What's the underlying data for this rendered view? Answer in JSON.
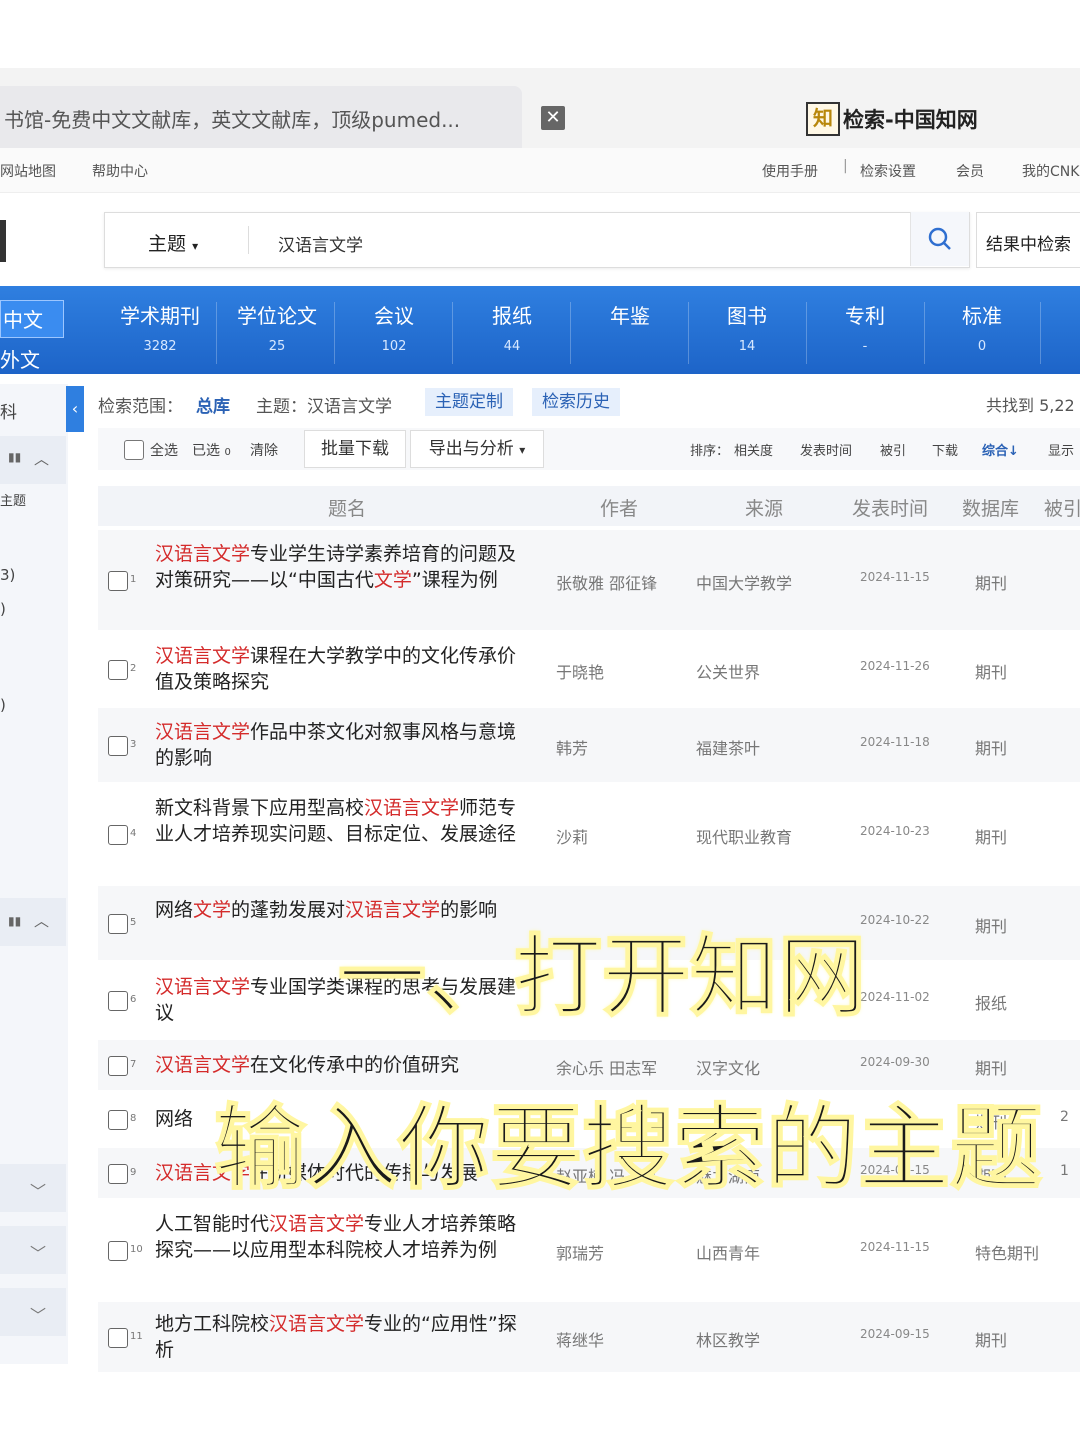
{
  "browser": {
    "tab1_title": "书馆-免费中文文献库，英文文献库，顶级pumed...",
    "tab2_logo": "知",
    "tab2_title": "检索-中国知网"
  },
  "util_links": [
    "网站地图",
    "帮助中心",
    "使用手册",
    "检索设置",
    "会员",
    "我的CNKI"
  ],
  "search": {
    "field": "主题",
    "query": "汉语言文学",
    "in_result_label": "结果中检索"
  },
  "lang": [
    "中文",
    "外文"
  ],
  "db_tabs": [
    {
      "label": "学术期刊",
      "count": "3282"
    },
    {
      "label": "学位论文",
      "count": "25"
    },
    {
      "label": "会议",
      "count": "102"
    },
    {
      "label": "报纸",
      "count": "44"
    },
    {
      "label": "年鉴",
      "count": ""
    },
    {
      "label": "图书",
      "count": "14"
    },
    {
      "label": "专利",
      "count": "-"
    },
    {
      "label": "标准",
      "count": "0"
    }
  ],
  "sidebar": {
    "items": [
      "科",
      "主题",
      "3)",
      ")",
      ")"
    ]
  },
  "range": {
    "label": "检索范围：",
    "scope": "总库",
    "topic": "主题：汉语言文学",
    "chip1": "主题定制",
    "chip2": "检索历史",
    "found": "共找到 5,22"
  },
  "toolbar": {
    "select_all": "全选",
    "selected": "已选",
    "selected_count": "0",
    "clear": "清除",
    "bulk_download": "批量下载",
    "export": "导出与分析",
    "sort_label": "排序：",
    "sort_options": [
      "相关度",
      "发表时间",
      "被引",
      "下载",
      "综合"
    ],
    "display": "显示"
  },
  "table": {
    "headers": [
      "题名",
      "作者",
      "来源",
      "发表时间",
      "数据库",
      "被引"
    ],
    "rows": [
      {
        "num": "1",
        "title": [
          [
            "汉语言文学",
            true
          ],
          [
            "专业学生诗学素养培育的问题及对策研究——以“中国古代",
            false
          ],
          [
            "文学",
            true
          ],
          [
            "”课程为例",
            false
          ]
        ],
        "author": "张敬雅 邵征锋",
        "source": "中国大学教学",
        "date": "2024-11-15",
        "db": "期刊",
        "cited": ""
      },
      {
        "num": "2",
        "title": [
          [
            "汉语言文学",
            true
          ],
          [
            "课程在大学教学中的文化传承价值及策略探究",
            false
          ]
        ],
        "author": "于晓艳",
        "source": "公关世界",
        "date": "2024-11-26",
        "db": "期刊",
        "cited": ""
      },
      {
        "num": "3",
        "title": [
          [
            "汉语言文学",
            true
          ],
          [
            "作品中茶文化对叙事风格与意境的影响",
            false
          ]
        ],
        "author": "韩芳",
        "source": "福建茶叶",
        "date": "2024-11-18",
        "db": "期刊",
        "cited": ""
      },
      {
        "num": "4",
        "title": [
          [
            "新文科背景下应用型高校",
            false
          ],
          [
            "汉语言文学",
            true
          ],
          [
            "师范专业人才培养现实问题、目标定位、发展途径",
            false
          ]
        ],
        "author": "沙莉",
        "source": "现代职业教育",
        "date": "2024-10-23",
        "db": "期刊",
        "cited": ""
      },
      {
        "num": "5",
        "title": [
          [
            "网络",
            false
          ],
          [
            "文学",
            true
          ],
          [
            "的蓬勃发展对",
            false
          ],
          [
            "汉语言文学",
            true
          ],
          [
            "的影响",
            false
          ]
        ],
        "author": "",
        "source": "",
        "date": "2024-10-22",
        "db": "期刊",
        "cited": ""
      },
      {
        "num": "6",
        "title": [
          [
            "汉语言文学",
            true
          ],
          [
            "专业国学类课程的思考与发展建议",
            false
          ]
        ],
        "author": "",
        "source": "",
        "date": "2024-11-02",
        "db": "报纸",
        "cited": ""
      },
      {
        "num": "7",
        "title": [
          [
            "汉语言文学",
            true
          ],
          [
            "在文化传承中的价值研究",
            false
          ]
        ],
        "author": "余心乐 田志军",
        "source": "汉字文化",
        "date": "2024-09-30",
        "db": "期刊",
        "cited": ""
      },
      {
        "num": "8",
        "title": [
          [
            "网络",
            false
          ]
        ],
        "author": "",
        "source": "",
        "date": "",
        "db": "期刊",
        "cited": "2"
      },
      {
        "num": "9",
        "title": [
          [
            "汉语言文学",
            true
          ],
          [
            "在新媒体时代的传播与发展",
            false
          ]
        ],
        "author": "赵亚楠 冯三等",
        "source": "魅力湖南",
        "date": "2024-08-15",
        "db": "期刊",
        "cited": "1"
      },
      {
        "num": "10",
        "title": [
          [
            "人工智能时代",
            false
          ],
          [
            "汉语言文学",
            true
          ],
          [
            "专业人才培养策略探究——以应用型本科院校人才培养为例",
            false
          ]
        ],
        "author": "郭瑞芳",
        "source": "山西青年",
        "date": "2024-11-15",
        "db": "特色期刊",
        "cited": ""
      },
      {
        "num": "11",
        "title": [
          [
            "地方工科院校",
            false
          ],
          [
            "汉语言文学",
            true
          ],
          [
            "专业的“应用性”探析",
            false
          ]
        ],
        "author": "蒋继华",
        "source": "林区教学",
        "date": "2024-09-15",
        "db": "期刊",
        "cited": ""
      }
    ]
  },
  "captions": {
    "line1": "一、打开知网",
    "line2": "输入你要搜索的主题"
  },
  "colors": {
    "nav_blue": "#2f7fe0",
    "highlight_red": "#d42b2b",
    "chip_blue": "#2b62b5"
  }
}
